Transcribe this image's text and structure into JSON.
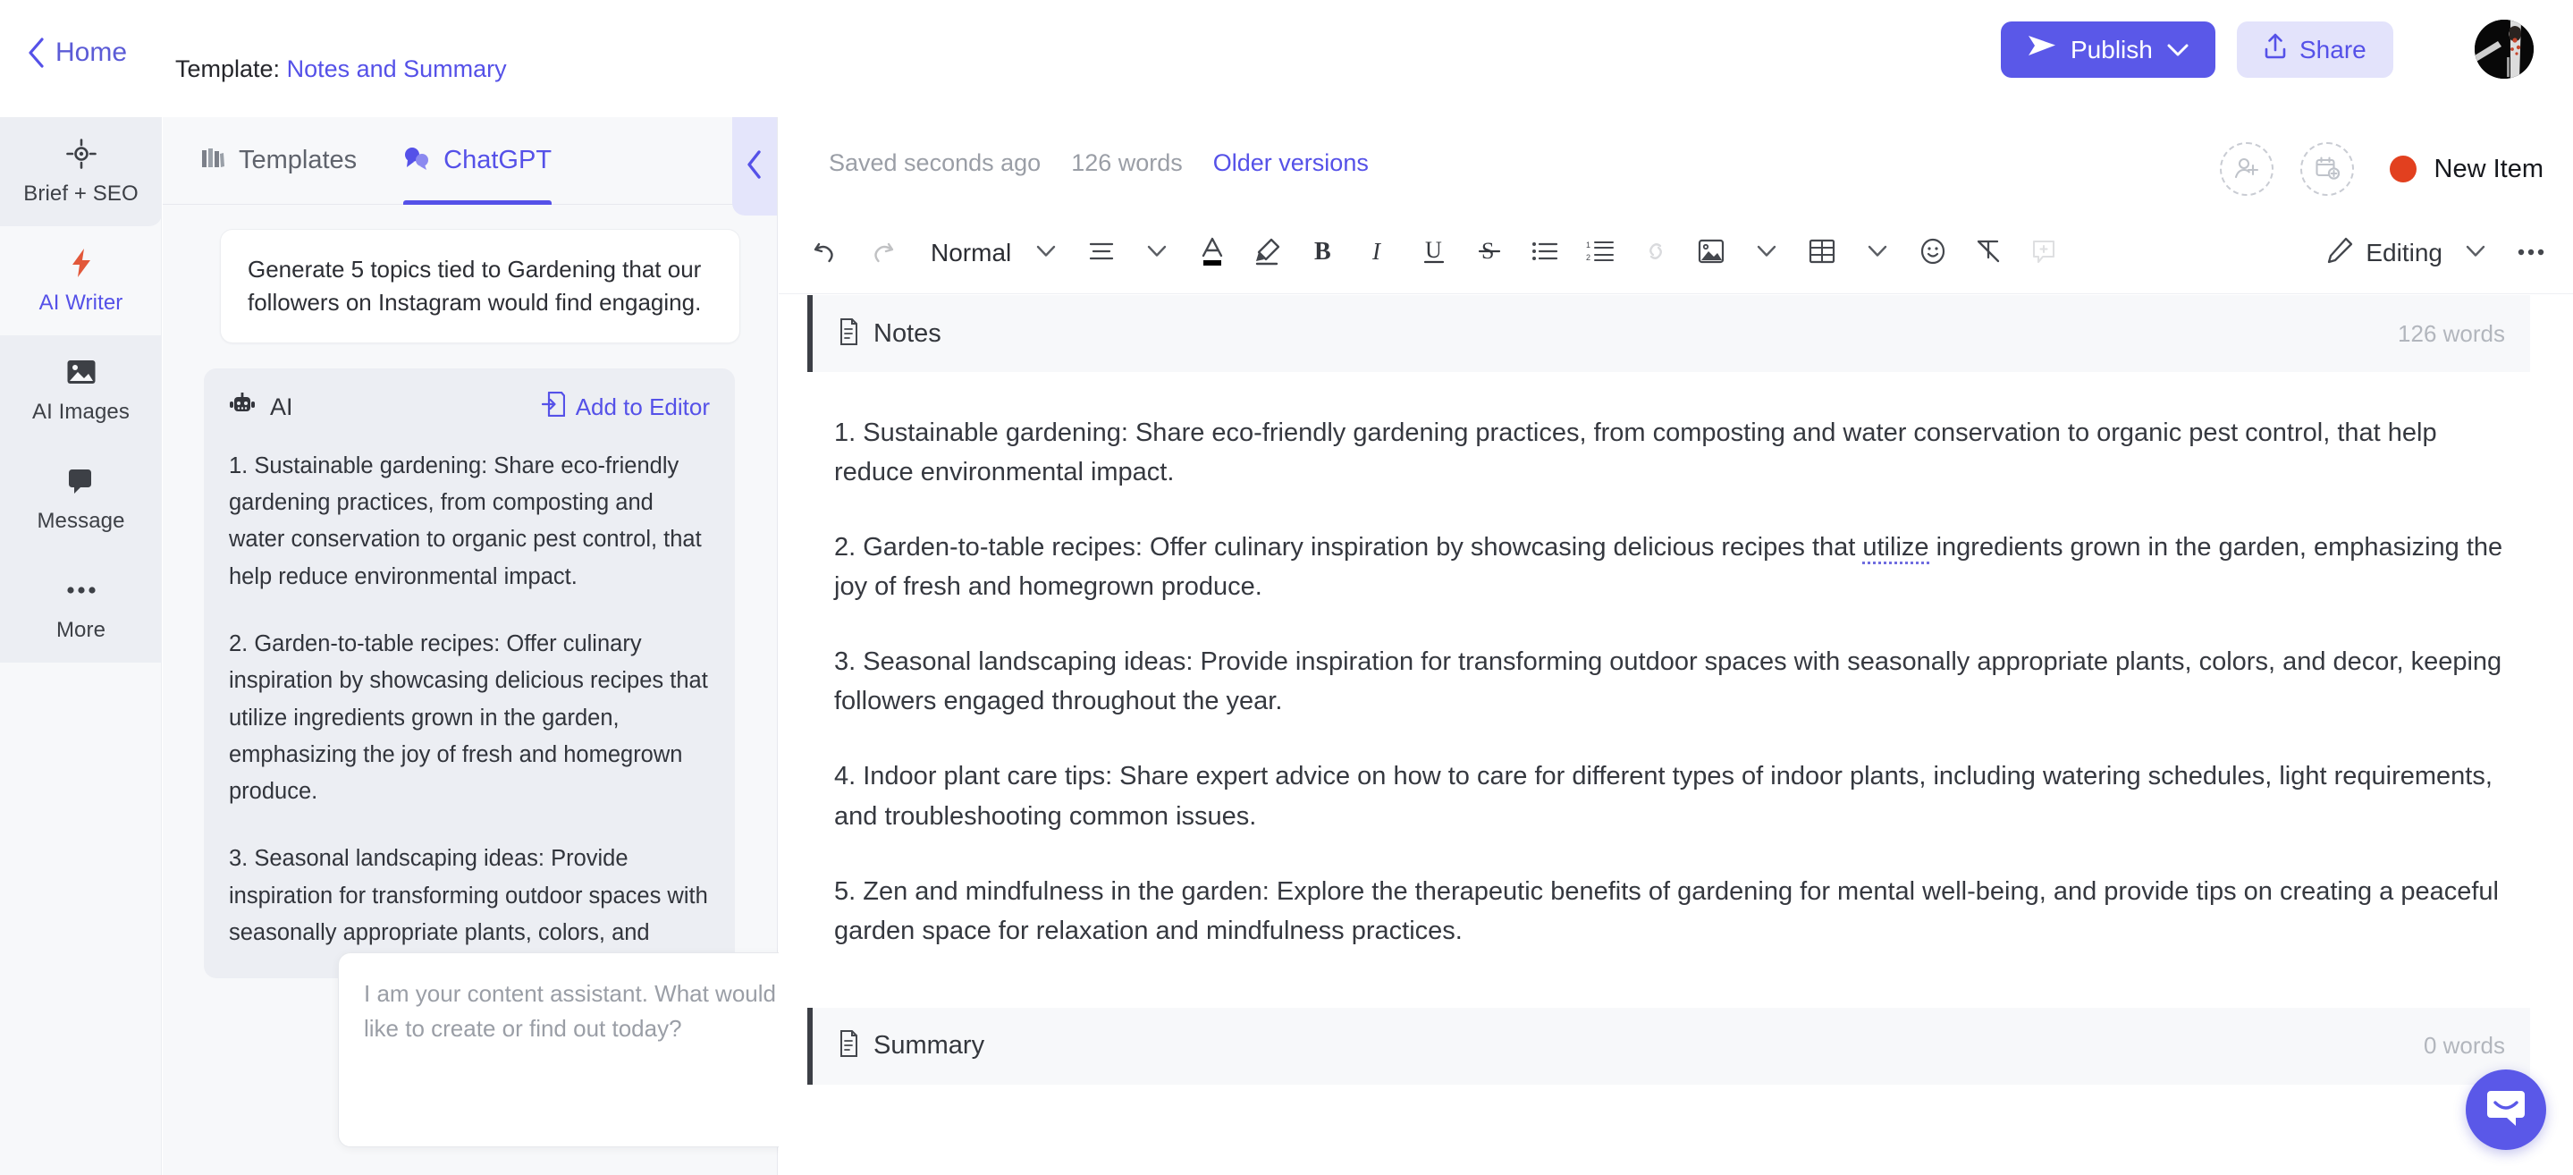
{
  "topbar": {
    "home_label": "Home",
    "template_prefix": "Template:",
    "template_name": "Notes and Summary",
    "publish_label": "Publish",
    "share_label": "Share",
    "accent_color": "#5551e8",
    "publish_bg": "#5a58e8",
    "share_bg": "#e3e3fb"
  },
  "rail": {
    "items": [
      {
        "label": "Brief + SEO",
        "icon": "target-icon",
        "active": false,
        "shaded": true
      },
      {
        "label": "AI Writer",
        "icon": "lightning-icon",
        "active": true,
        "shaded": false
      },
      {
        "label": "AI Images",
        "icon": "image-icon",
        "active": false,
        "shaded": true
      },
      {
        "label": "Message",
        "icon": "chat-bubble-icon",
        "active": false,
        "shaded": true
      },
      {
        "label": "More",
        "icon": "ellipsis-icon",
        "active": false,
        "shaded": true
      }
    ]
  },
  "panel": {
    "tabs": [
      {
        "label": "Templates",
        "icon": "books-icon",
        "active": false
      },
      {
        "label": "ChatGPT",
        "icon": "chat-bubbles-icon",
        "active": true
      }
    ],
    "collapse_icon": "chevron-left-icon",
    "user_message": "Generate 5 topics tied to Gardening that our followers on Instagram would find engaging.",
    "ai_label": "AI",
    "add_to_editor_label": "Add to Editor",
    "ai_paragraphs": [
      "1. Sustainable gardening: Share eco-friendly gardening practices, from composting and water conservation to organic pest control, that help reduce environmental impact.",
      "2. Garden-to-table recipes: Offer culinary inspiration by showcasing delicious recipes that utilize ingredients grown in the garden, emphasizing the joy of fresh and homegrown produce.",
      "3. Seasonal landscaping ideas: Provide inspiration for transforming outdoor spaces with seasonally appropriate plants, colors, and"
    ],
    "composer_placeholder": "I am your content assistant. What would you like to create or find out today?",
    "composer_value": "",
    "send_icon": "send-icon"
  },
  "editor": {
    "saved_text": "Saved seconds ago",
    "word_count": "126 words",
    "older_versions_label": "Older versions",
    "add_collaborator_icon": "add-person-icon",
    "add_schedule_icon": "add-calendar-icon",
    "status_label": "New Item",
    "status_color": "#e2401f",
    "toolbar": {
      "undo_label": "Undo",
      "redo_label": "Redo",
      "style_name": "Normal",
      "align_label": "Align",
      "text_color_label": "Text color",
      "highlight_label": "Highlight",
      "bold_label": "Bold",
      "italic_label": "Italic",
      "underline_label": "Underline",
      "strikethrough_label": "Strikethrough",
      "bullet_list_label": "Bulleted list",
      "numbered_list_label": "Numbered list",
      "link_label": "Link",
      "image_label": "Image",
      "table_label": "Table",
      "emoji_label": "Emoji",
      "clear_format_label": "Clear formatting",
      "comment_label": "Comment",
      "mode_label": "Editing"
    },
    "sections": [
      {
        "icon": "document-icon",
        "title": "Notes",
        "word_count": "126 words",
        "paragraphs": [
          {
            "pre": "1. Sustainable gardening: Share eco-friendly gardening practices, from composting and water conservation to organic pest control, that help reduce environmental impact.",
            "mark": "",
            "post": ""
          },
          {
            "pre": "2. Garden-to-table recipes: Offer culinary inspiration by showcasing delicious recipes that ",
            "mark": "utilize",
            "post": " ingredients grown in the garden, emphasizing the joy of fresh and homegrown produce."
          },
          {
            "pre": "3. Seasonal landscaping ideas: Provide inspiration for transforming outdoor spaces with seasonally appropriate plants, colors, and decor, keeping followers engaged throughout the year.",
            "mark": "",
            "post": ""
          },
          {
            "pre": "4. Indoor plant care tips: Share expert advice on how to care for different types of indoor plants, including watering schedules, light requirements, and troubleshooting common issues.",
            "mark": "",
            "post": ""
          },
          {
            "pre": "5. Zen and mindfulness in the garden: Explore the therapeutic benefits of gardening for mental well-being, and provide tips on creating a peaceful garden space for relaxation and mindfulness practices.",
            "mark": "",
            "post": ""
          }
        ]
      },
      {
        "icon": "document-icon",
        "title": "Summary",
        "word_count": "0 words",
        "paragraphs": []
      }
    ]
  },
  "intercom": {
    "icon": "intercom-chat-icon",
    "color": "#5a58e8"
  }
}
